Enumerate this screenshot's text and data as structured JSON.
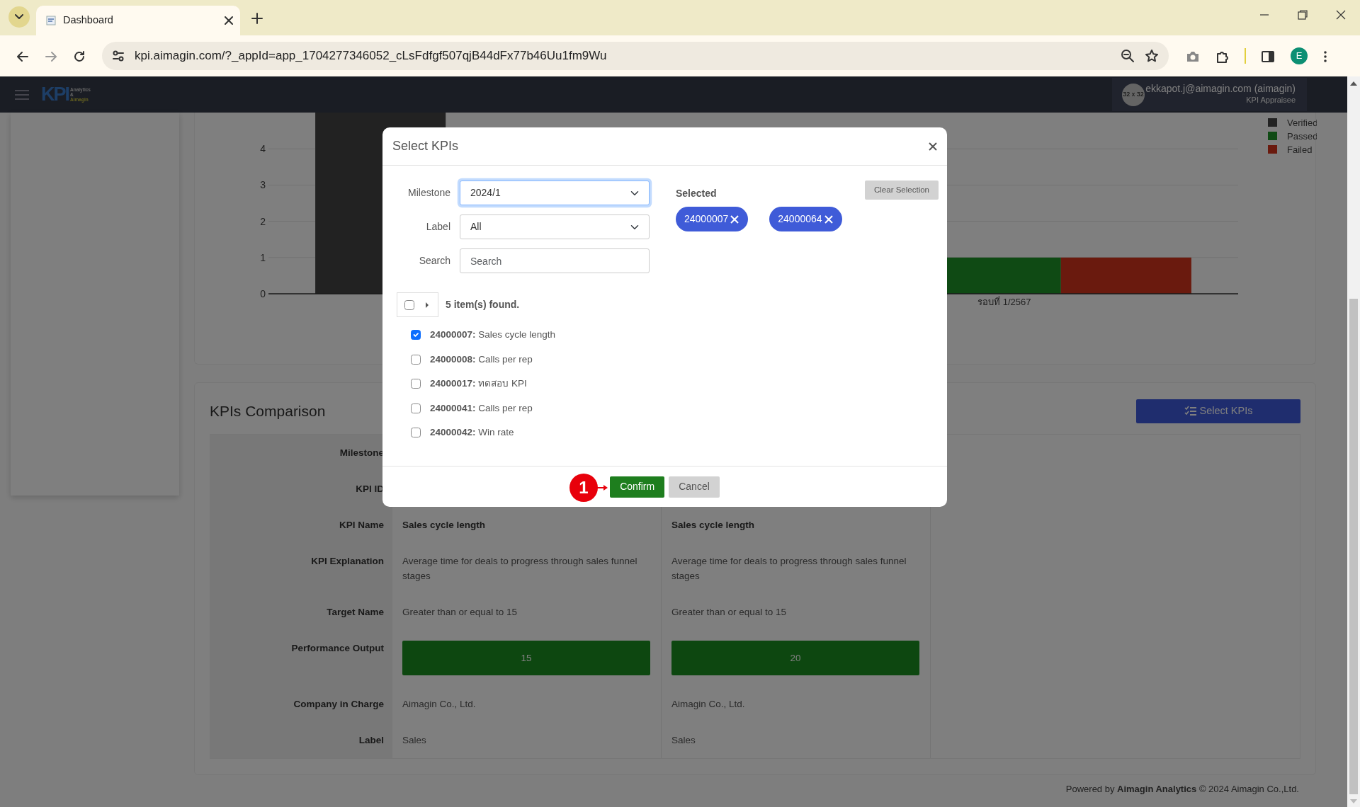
{
  "browser": {
    "tab_title": "Dashboard",
    "url": "kpi.aimagin.com/?_appId=app_1704277346052_cLsFdfgf507qjB44dFx77b46Uu1fm9Wu",
    "profile_initial": "E"
  },
  "navbar": {
    "logo": "KPI",
    "logo_tagline": [
      "Analytics",
      "&",
      "Aimagin"
    ],
    "avatar_text": "32 x 32",
    "user": "ekkapot.j@aimagin.com (aimagin)",
    "role": "KPI Appraisee"
  },
  "status_chart": {
    "chart_data": {
      "type": "bar",
      "categories": [
        null,
        "รอบที่ 1/2567"
      ],
      "series": [
        {
          "name": "Verified",
          "color": "#444444",
          "values": [
            5,
            null
          ]
        },
        {
          "name": "Passed",
          "color": "#1e9428",
          "values": [
            null,
            1
          ]
        },
        {
          "name": "Failed",
          "color": "#d4341c",
          "values": [
            null,
            1
          ]
        }
      ],
      "ylim": [
        0,
        5
      ],
      "yticks": [
        0,
        1,
        2,
        3,
        4
      ],
      "grid": true,
      "legend": true
    }
  },
  "comparison": {
    "title": "KPIs Comparison",
    "select_button": "Select KPIs",
    "rows": [
      {
        "label": "Milestone"
      },
      {
        "label": "KPI ID"
      },
      {
        "label": "KPI Name",
        "kind": "bold",
        "values": [
          "Sales cycle length",
          "Sales cycle length"
        ]
      },
      {
        "label": "KPI Explanation",
        "kind": "text",
        "values": [
          "Average time for deals to progress through sales funnel stages",
          "Average time for deals to progress through sales funnel stages"
        ]
      },
      {
        "label": "Target Name",
        "kind": "text",
        "values": [
          "Greater than or equal to 15",
          "Greater than or equal to 15"
        ]
      },
      {
        "label": "Performance Output",
        "kind": "result",
        "values": [
          {
            "text": "15",
            "passed": true
          },
          {
            "text": "20",
            "passed": true
          }
        ]
      },
      {
        "label": "Company in Charge",
        "kind": "text",
        "values": [
          "Aimagin Co., Ltd.",
          "Aimagin Co., Ltd."
        ]
      },
      {
        "label": "Label",
        "kind": "text",
        "values": [
          "Sales",
          "Sales"
        ]
      }
    ]
  },
  "footer": "Powered by **Aimagin Analytics** © 2024 Aimagin Co.,Ltd.",
  "modal": {
    "title": "Select KPIs",
    "filters": [
      {
        "label": "Milestone",
        "kind": "select",
        "value": "2024/1",
        "focused": true
      },
      {
        "label": "Label",
        "kind": "select",
        "value": "All",
        "focused": false
      },
      {
        "label": "Search",
        "kind": "input",
        "placeholder": "Search",
        "focused": false
      }
    ],
    "selected_title": "Selected",
    "clear_button": "Clear Selection",
    "chips": [
      "24000007",
      "24000064"
    ],
    "tree": {
      "checked": false,
      "expanded": false,
      "summary": "5 item(s) found."
    },
    "items": [
      {
        "text": "**24000007:** Sales cycle length",
        "checked": true
      },
      {
        "text": "**24000008:** Calls per rep",
        "checked": false
      },
      {
        "text": "**24000017:** ทดสอบ KPI",
        "checked": false
      },
      {
        "text": "**24000041:** Calls per rep",
        "checked": false
      },
      {
        "text": "**24000042:** Win rate",
        "checked": false
      }
    ],
    "buttons": [
      {
        "label": "Confirm",
        "kind": "primary"
      },
      {
        "label": "Cancel",
        "kind": "secondary"
      }
    ]
  },
  "annotation": {
    "number": "1"
  }
}
